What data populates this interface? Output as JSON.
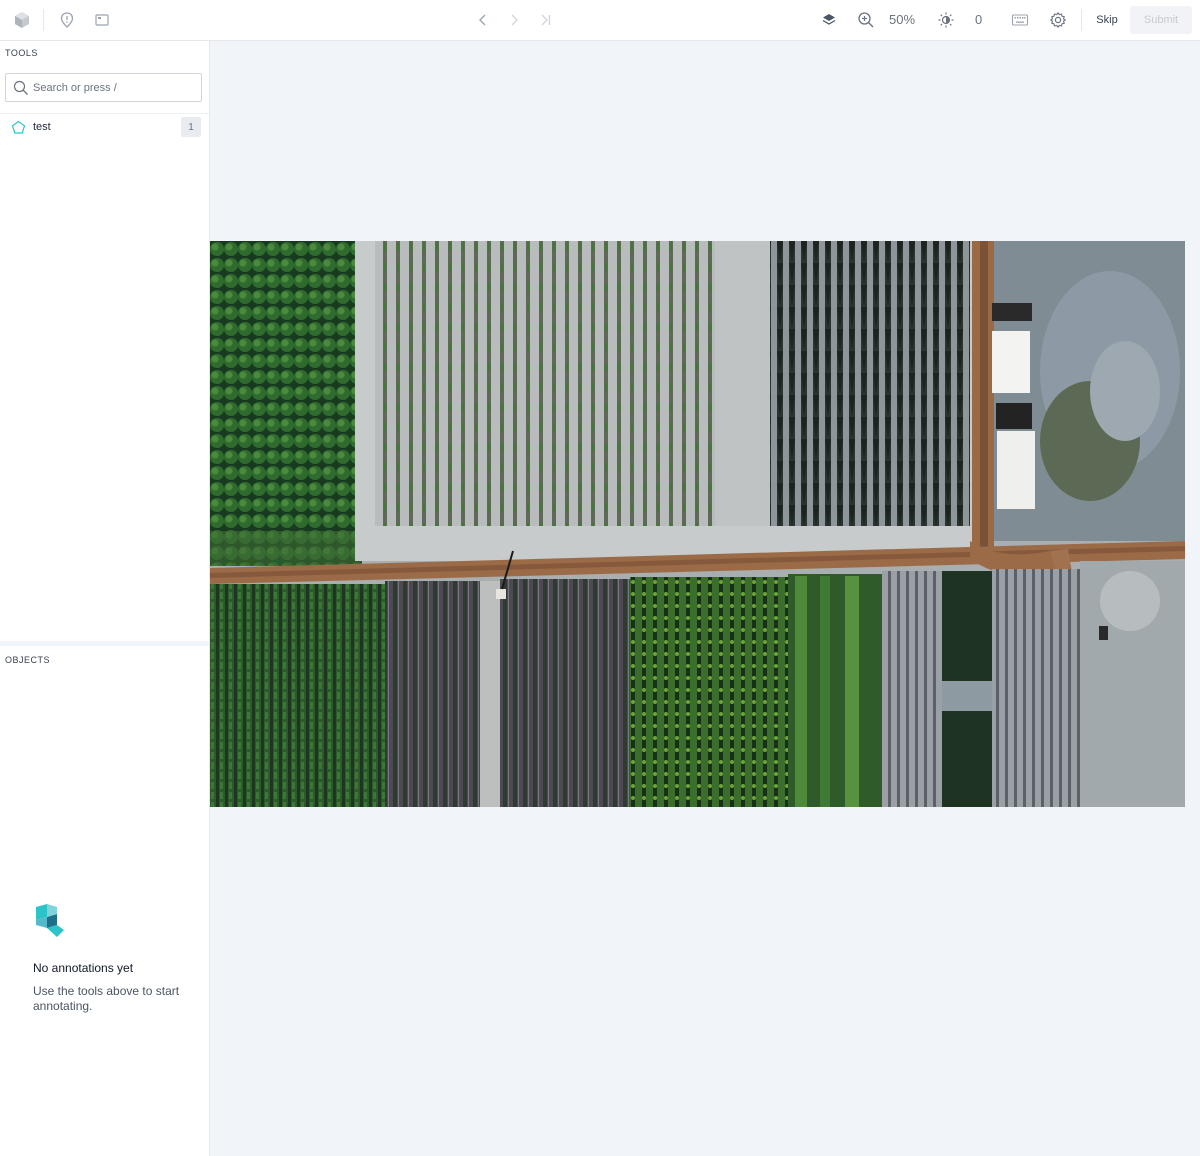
{
  "topbar": {
    "zoom": "50%",
    "brightness": "0",
    "skip_label": "Skip",
    "submit_label": "Submit",
    "icons": [
      "cube-logo-icon",
      "pin-icon",
      "panel-icon",
      "chevron-left-icon",
      "chevron-right-icon",
      "skip-end-icon",
      "layers-icon",
      "zoom-in-icon",
      "brightness-icon",
      "keyboard-icon",
      "gear-icon"
    ]
  },
  "sidebar": {
    "tools_title": "TOOLS",
    "search_placeholder": "Search or press /",
    "tools": [
      {
        "label": "test",
        "count": "1",
        "icon": "polygon-icon",
        "color": "#2cc3c9"
      }
    ],
    "objects_title": "OBJECTS",
    "empty": {
      "title": "No annotations yet",
      "description": "Use the tools above to start annotating."
    }
  },
  "canvas": {
    "background": "#f1f4f8",
    "image_alt": "Aerial view of orchard fields and farm buildings"
  },
  "colors": {
    "accent": "#2cc3c9",
    "border": "#e5e7eb",
    "canvas_bg": "#f1f4f8"
  }
}
